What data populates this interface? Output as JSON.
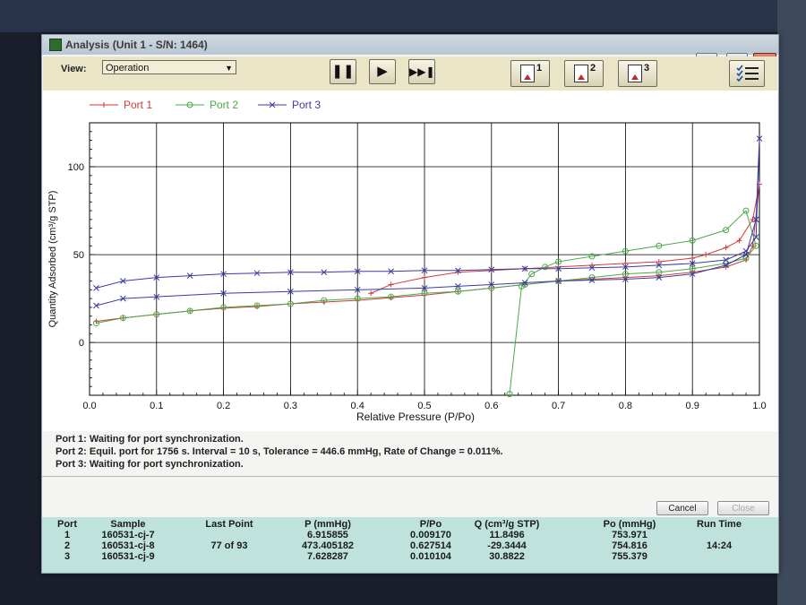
{
  "window": {
    "title": "Analysis (Unit 1 - S/N: 1464)",
    "controls": {
      "minimize": "—",
      "restore": "▭",
      "close": "✕"
    }
  },
  "toolbar": {
    "view_label": "View:",
    "view_value": "Operation",
    "report_numbers": [
      "1",
      "2",
      "3"
    ]
  },
  "chart_data": {
    "type": "line",
    "xlabel": "Relative Pressure (P/Po)",
    "ylabel": "Quantity Adsorbed (cm³/g STP)",
    "xlim": [
      0.0,
      1.0
    ],
    "ylim": [
      -30,
      125
    ],
    "xticks": [
      "0.0",
      "0.1",
      "0.2",
      "0.3",
      "0.4",
      "0.5",
      "0.6",
      "0.7",
      "0.8",
      "0.9",
      "1.0"
    ],
    "yticks": [
      "0",
      "50",
      "100"
    ],
    "grid": true,
    "legend_position": "top-left",
    "series": [
      {
        "name": "Port 1",
        "color": "#d43a3a",
        "marker": "plus",
        "points": [
          [
            0.01,
            12
          ],
          [
            0.05,
            14
          ],
          [
            0.1,
            16
          ],
          [
            0.15,
            18
          ],
          [
            0.2,
            19.5
          ],
          [
            0.25,
            20.5
          ],
          [
            0.3,
            22
          ],
          [
            0.35,
            23
          ],
          [
            0.4,
            24
          ],
          [
            0.45,
            25.5
          ],
          [
            0.5,
            27
          ],
          [
            0.55,
            29
          ],
          [
            0.6,
            31
          ],
          [
            0.65,
            33
          ],
          [
            0.7,
            35
          ],
          [
            0.75,
            36
          ],
          [
            0.8,
            37
          ],
          [
            0.85,
            38
          ],
          [
            0.9,
            40
          ],
          [
            0.95,
            43
          ],
          [
            0.98,
            47
          ],
          [
            0.99,
            55
          ],
          [
            1.0,
            90
          ],
          [
            0.99,
            70
          ],
          [
            0.97,
            58
          ],
          [
            0.95,
            54
          ],
          [
            0.92,
            50
          ],
          [
            0.9,
            48
          ],
          [
            0.85,
            46
          ],
          [
            0.8,
            45
          ],
          [
            0.75,
            44
          ],
          [
            0.7,
            43
          ],
          [
            0.65,
            42
          ],
          [
            0.6,
            41
          ],
          [
            0.55,
            40
          ],
          [
            0.5,
            37
          ],
          [
            0.45,
            33
          ],
          [
            0.42,
            28
          ]
        ]
      },
      {
        "name": "Port 2",
        "color": "#4aa84a",
        "marker": "circle",
        "points": [
          [
            0.01,
            11
          ],
          [
            0.05,
            14
          ],
          [
            0.1,
            16
          ],
          [
            0.15,
            18
          ],
          [
            0.2,
            20
          ],
          [
            0.25,
            21
          ],
          [
            0.3,
            22
          ],
          [
            0.35,
            24
          ],
          [
            0.4,
            25
          ],
          [
            0.45,
            26
          ],
          [
            0.5,
            28
          ],
          [
            0.55,
            29
          ],
          [
            0.6,
            31
          ],
          [
            0.65,
            33
          ],
          [
            0.7,
            35
          ],
          [
            0.75,
            37
          ],
          [
            0.8,
            39
          ],
          [
            0.85,
            40
          ],
          [
            0.9,
            42
          ],
          [
            0.95,
            45
          ],
          [
            0.98,
            48
          ],
          [
            0.995,
            55
          ],
          [
            0.98,
            75
          ],
          [
            0.95,
            64
          ],
          [
            0.9,
            58
          ],
          [
            0.85,
            55
          ],
          [
            0.8,
            52
          ],
          [
            0.75,
            49
          ],
          [
            0.7,
            46
          ],
          [
            0.68,
            43
          ],
          [
            0.66,
            39
          ],
          [
            0.645,
            32
          ],
          [
            0.627,
            -29.3
          ]
        ]
      },
      {
        "name": "Port 3",
        "color": "#3b3ba0",
        "marker": "x",
        "points": [
          [
            0.01,
            31
          ],
          [
            0.05,
            35
          ],
          [
            0.1,
            37
          ],
          [
            0.15,
            38
          ],
          [
            0.2,
            39
          ],
          [
            0.25,
            39.5
          ],
          [
            0.3,
            40
          ],
          [
            0.35,
            40
          ],
          [
            0.4,
            40.5
          ],
          [
            0.45,
            40.5
          ],
          [
            0.5,
            41
          ],
          [
            0.55,
            41
          ],
          [
            0.6,
            41.5
          ],
          [
            0.65,
            42
          ],
          [
            0.7,
            42
          ],
          [
            0.75,
            42.5
          ],
          [
            0.8,
            43
          ],
          [
            0.85,
            44
          ],
          [
            0.9,
            45
          ],
          [
            0.95,
            47
          ],
          [
            0.98,
            52
          ],
          [
            0.995,
            60
          ],
          [
            1.0,
            116
          ],
          [
            0.995,
            70
          ],
          [
            0.98,
            50
          ],
          [
            0.95,
            44
          ],
          [
            0.9,
            39
          ],
          [
            0.85,
            37
          ],
          [
            0.8,
            36
          ],
          [
            0.75,
            35.5
          ],
          [
            0.7,
            35
          ],
          [
            0.65,
            34
          ],
          [
            0.6,
            33
          ],
          [
            0.55,
            32
          ],
          [
            0.5,
            31
          ],
          [
            0.4,
            30
          ],
          [
            0.3,
            29
          ],
          [
            0.2,
            28
          ],
          [
            0.1,
            26
          ],
          [
            0.05,
            25
          ],
          [
            0.01,
            21
          ]
        ]
      }
    ]
  },
  "status": {
    "lines": [
      "Port 1:  Waiting for port synchronization.",
      "Port 2:  Equil. port for 1756 s. Interval = 10 s, Tolerance = 446.6 mmHg, Rate of Change = 0.011%.",
      "Port 3:  Waiting for port synchronization."
    ]
  },
  "buttons": {
    "cancel": "Cancel",
    "close": "Close"
  },
  "table": {
    "headers": [
      "Port",
      "Sample",
      "Last Point",
      "P (mmHg)",
      "P/Po",
      "Q (cm³/g STP)",
      "Po (mmHg)",
      "Run Time"
    ],
    "rows": [
      [
        "1",
        "160531-cj-7",
        "",
        "6.915855",
        "0.009170",
        "11.8496",
        "753.971",
        ""
      ],
      [
        "2",
        "160531-cj-8",
        "77 of 93",
        "473.405182",
        "0.627514",
        "-29.3444",
        "754.816",
        "14:24"
      ],
      [
        "3",
        "160531-cj-9",
        "",
        "7.628287",
        "0.010104",
        "30.8822",
        "755.379",
        ""
      ]
    ]
  }
}
